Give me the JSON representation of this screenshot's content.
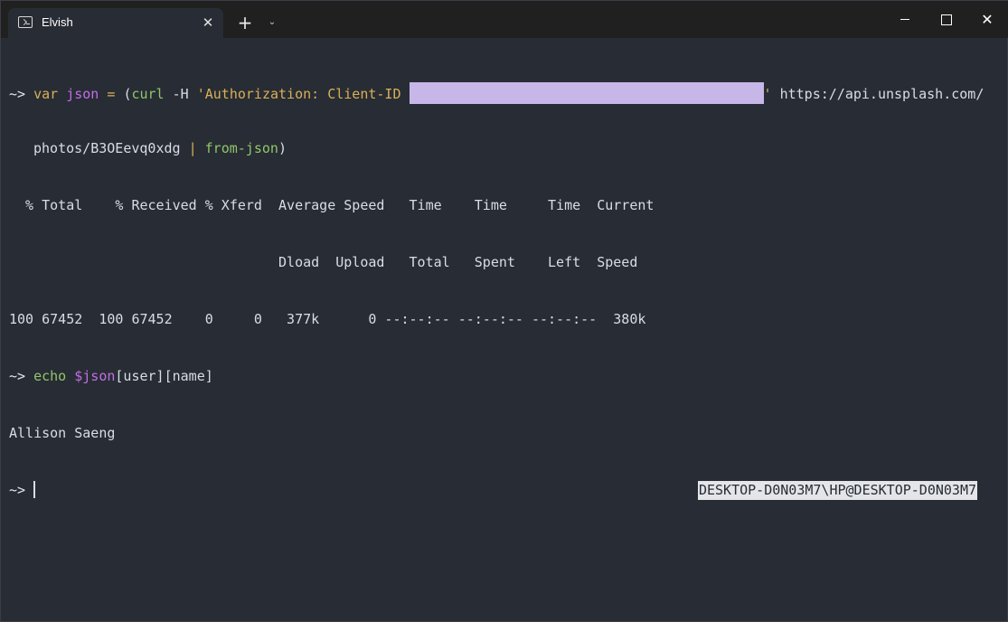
{
  "tab": {
    "title": "Elvish",
    "close": "✕"
  },
  "titlebar": {
    "new_tab": "+",
    "dropdown": "⌄",
    "close": "✕"
  },
  "terminal": {
    "prompt": "~>",
    "cmd1": {
      "kw": "var",
      "var": "json",
      "eq": "=",
      "open": "(",
      "curl": "curl",
      "flag": "-H",
      "str_start": "'Authorization: Client-ID ",
      "str_end": "'",
      "url_part1": "https://api.unsplash.com/",
      "url_part2": "photos/B3OEevq0xdg",
      "pipe": "|",
      "fromjson": "from-json",
      "close": ")"
    },
    "curl_header1": "  % Total    % Received % Xferd  Average Speed   Time    Time     Time  Current",
    "curl_header2": "                                 Dload  Upload   Total   Spent    Left  Speed",
    "curl_stats": "100 67452  100 67452    0     0   377k      0 --:--:-- --:--:-- --:--:--  380k",
    "cmd2": {
      "echo": "echo",
      "var": "$json",
      "rest": "[user][name]"
    },
    "output": "Allison Saeng",
    "right_prompt": "DESKTOP-D0N03M7\\HP@DESKTOP-D0N03M7"
  },
  "colors": {
    "background": "#282c34",
    "titlebar": "#202020",
    "keyword": "#d8b058",
    "variable": "#c06ee8",
    "command": "#8fc76a",
    "redaction": "#c7b7e8"
  }
}
